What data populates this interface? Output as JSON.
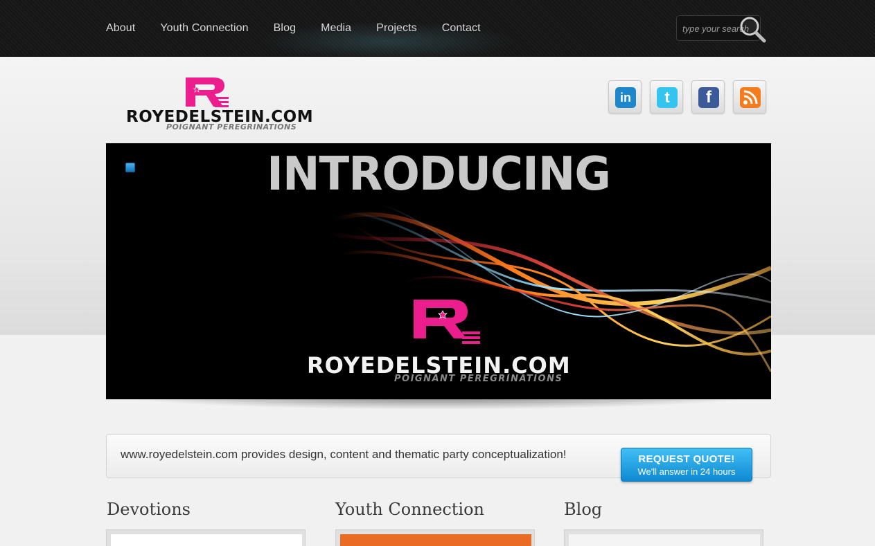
{
  "nav": {
    "items": [
      {
        "label": "About"
      },
      {
        "label": "Youth Connection"
      },
      {
        "label": "Blog"
      },
      {
        "label": "Media"
      },
      {
        "label": "Projects"
      },
      {
        "label": "Contact"
      }
    ]
  },
  "search": {
    "placeholder": "type your search"
  },
  "logo": {
    "name": "ROYEDELSTEIN.COM",
    "tagline": "POIGNANT PEREGRINATIONS"
  },
  "social": [
    {
      "name": "linkedin-icon",
      "glyph": "in",
      "color": "#1d87c9"
    },
    {
      "name": "twitter-icon",
      "glyph": "t",
      "color": "#35c4f0"
    },
    {
      "name": "facebook-icon",
      "glyph": "f",
      "color": "#3b5a9a"
    },
    {
      "name": "rss-icon",
      "glyph": "",
      "color": "#f47c1c"
    }
  ],
  "slider": {
    "heading": "INTRODUCING",
    "name": "ROYEDELSTEIN.COM",
    "tagline": "POIGNANT PEREGRINATIONS"
  },
  "intro": {
    "text": "www.royedelstein.com provides design, content and thematic party conceptualization!",
    "button_title": "REQUEST QUOTE!",
    "button_subtitle": "We'll answer in 24 hours"
  },
  "columns": [
    {
      "title": "Devotions",
      "thumb_color": "#ffffff"
    },
    {
      "title": "Youth Connection",
      "thumb_color": "#ea6b24"
    },
    {
      "title": "Blog",
      "thumb_color": "#f4f4f4"
    }
  ],
  "colors": {
    "accent": "#ec1d8c",
    "button": "#1ba3e4"
  }
}
